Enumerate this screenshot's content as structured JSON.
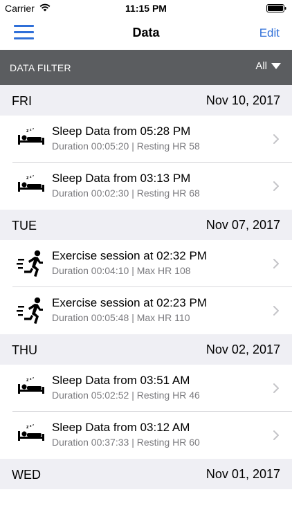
{
  "status_bar": {
    "carrier": "Carrier",
    "time": "11:15 PM"
  },
  "nav": {
    "title": "Data",
    "edit_label": "Edit",
    "menu_icon": "hamburger-menu-icon",
    "accent_color": "#2f6fd8"
  },
  "filter": {
    "label": "DATA FILTER",
    "value": "All",
    "bar_color": "#5b5d60"
  },
  "sections": [
    {
      "day": "FRI",
      "date": "Nov 10, 2017",
      "items": [
        {
          "type": "sleep",
          "icon": "sleep-bed-icon",
          "title": "Sleep Data from 05:28 PM",
          "subtitle": "Duration 00:05:20 | Resting HR 58"
        },
        {
          "type": "sleep",
          "icon": "sleep-bed-icon",
          "title": "Sleep Data from 03:13 PM",
          "subtitle": "Duration 00:02:30 | Resting HR 68"
        }
      ]
    },
    {
      "day": "TUE",
      "date": "Nov 07, 2017",
      "items": [
        {
          "type": "exercise",
          "icon": "running-person-icon",
          "title": "Exercise session at 02:32 PM",
          "subtitle": "Duration 00:04:10 | Max HR 108"
        },
        {
          "type": "exercise",
          "icon": "running-person-icon",
          "title": "Exercise session at 02:23 PM",
          "subtitle": "Duration 00:05:48 | Max HR 110"
        }
      ]
    },
    {
      "day": "THU",
      "date": "Nov 02, 2017",
      "items": [
        {
          "type": "sleep",
          "icon": "sleep-bed-icon",
          "title": "Sleep Data from 03:51 AM",
          "subtitle": "Duration 05:02:52 | Resting HR 46"
        },
        {
          "type": "sleep",
          "icon": "sleep-bed-icon",
          "title": "Sleep Data from 03:12 AM",
          "subtitle": "Duration 00:37:33 | Resting HR 60"
        }
      ]
    },
    {
      "day": "WED",
      "date": "Nov 01, 2017",
      "items": []
    }
  ]
}
